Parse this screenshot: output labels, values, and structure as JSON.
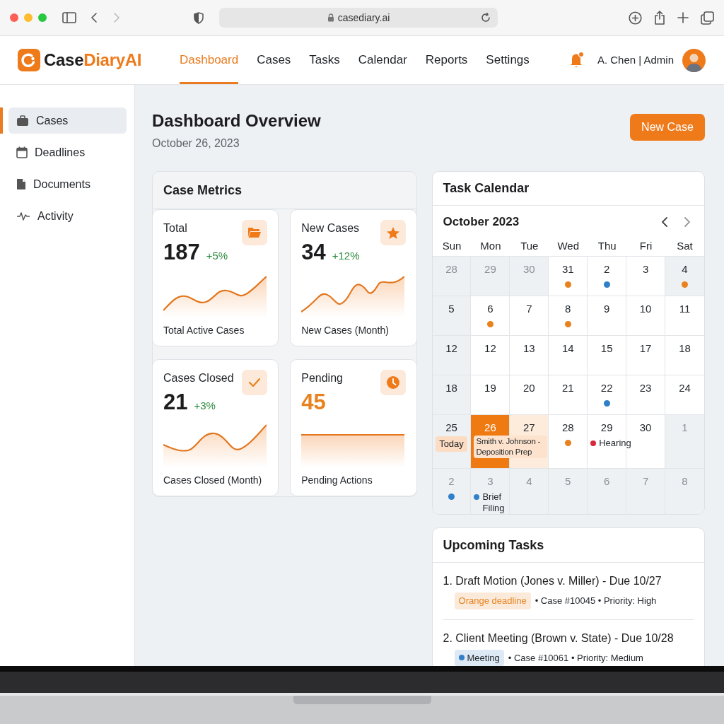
{
  "browser": {
    "url": "casediary.ai"
  },
  "brand": {
    "plain": "Case",
    "accent": "DiaryAI"
  },
  "nav": [
    {
      "label": "Dashboard",
      "selected": true
    },
    {
      "label": "Cases",
      "selected": false
    },
    {
      "label": "Tasks",
      "selected": false
    },
    {
      "label": "Calendar",
      "selected": false
    },
    {
      "label": "Reports",
      "selected": false
    },
    {
      "label": "Settings",
      "selected": false
    }
  ],
  "user": {
    "name": "A. Chen | Admin",
    "has_notification": true
  },
  "sidebar": {
    "items": [
      {
        "label": "Cases",
        "selected": true
      },
      {
        "label": "Deadlines",
        "selected": false
      },
      {
        "label": "Documents",
        "selected": false
      },
      {
        "label": "Activity",
        "selected": false
      }
    ]
  },
  "page": {
    "title": "Dashboard Overview",
    "date": "October 26, 2023",
    "primary_button": "New Case"
  },
  "metrics": {
    "title": "Case Metrics",
    "cards": [
      {
        "title": "Total",
        "value": "187",
        "change": "+5%",
        "caption": "Total Active Cases",
        "emphasized": false
      },
      {
        "title": "New Cases",
        "value": "34",
        "change": "+12%",
        "caption": "New Cases (Month)",
        "emphasized": false
      },
      {
        "title": "Cases Closed",
        "value": "21",
        "change": "+3%",
        "caption": "Cases Closed (Month)",
        "emphasized": false
      },
      {
        "title": "Pending",
        "value": "45",
        "caption": "Pending Actions",
        "emphasized": true
      }
    ]
  },
  "calendar": {
    "title": "Task Calendar",
    "month": "October 2023",
    "weekdays": [
      "Sun",
      "Mon",
      "Tue",
      "Wed",
      "Thu",
      "Fri",
      "Sat"
    ],
    "weeks": [
      [
        {
          "day": "28",
          "outside": true,
          "shaded": true,
          "today": false,
          "tinted": false
        },
        {
          "day": "29",
          "outside": true,
          "shaded": true,
          "today": false,
          "tinted": false
        },
        {
          "day": "30",
          "outside": true,
          "shaded": true,
          "today": false,
          "tinted": false
        },
        {
          "day": "31",
          "outside": false,
          "shaded": false,
          "today": false,
          "tinted": false,
          "dot": {
            "color": "#e8821e"
          }
        },
        {
          "day": "2",
          "outside": false,
          "shaded": false,
          "today": false,
          "tinted": false,
          "dot": {
            "color": "#2f80c9"
          }
        },
        {
          "day": "3",
          "outside": false,
          "shaded": false,
          "today": false,
          "tinted": false
        },
        {
          "day": "4",
          "outside": false,
          "shaded": true,
          "today": false,
          "tinted": false,
          "dot": {
            "color": "#e8821e"
          }
        }
      ],
      [
        {
          "day": "5",
          "outside": false,
          "shaded": true,
          "today": false,
          "tinted": false
        },
        {
          "day": "6",
          "outside": false,
          "shaded": false,
          "today": false,
          "tinted": false,
          "dot": {
            "color": "#e8821e"
          }
        },
        {
          "day": "7",
          "outside": false,
          "shaded": false,
          "today": false,
          "tinted": false
        },
        {
          "day": "8",
          "outside": false,
          "shaded": false,
          "today": false,
          "tinted": false,
          "dot": {
            "color": "#e8821e"
          }
        },
        {
          "day": "9",
          "outside": false,
          "shaded": false,
          "today": false,
          "tinted": false
        },
        {
          "day": "10",
          "outside": false,
          "shaded": false,
          "today": false,
          "tinted": false
        },
        {
          "day": "11",
          "outside": false,
          "shaded": false,
          "today": false,
          "tinted": false
        }
      ],
      [
        {
          "day": "12",
          "outside": false,
          "shaded": true,
          "today": false,
          "tinted": false
        },
        {
          "day": "12",
          "outside": false,
          "shaded": false,
          "today": false,
          "tinted": false
        },
        {
          "day": "13",
          "outside": false,
          "shaded": false,
          "today": false,
          "tinted": false
        },
        {
          "day": "14",
          "outside": false,
          "shaded": false,
          "today": false,
          "tinted": false
        },
        {
          "day": "15",
          "outside": false,
          "shaded": false,
          "today": false,
          "tinted": false
        },
        {
          "day": "17",
          "outside": false,
          "shaded": false,
          "today": false,
          "tinted": false
        },
        {
          "day": "18",
          "outside": false,
          "shaded": false,
          "today": false,
          "tinted": false
        }
      ],
      [
        {
          "day": "18",
          "outside": false,
          "shaded": true,
          "today": false,
          "tinted": false
        },
        {
          "day": "19",
          "outside": false,
          "shaded": false,
          "today": false,
          "tinted": false
        },
        {
          "day": "20",
          "outside": false,
          "shaded": false,
          "today": false,
          "tinted": false
        },
        {
          "day": "21",
          "outside": false,
          "shaded": false,
          "today": false,
          "tinted": false
        },
        {
          "day": "22",
          "outside": false,
          "shaded": false,
          "today": false,
          "tinted": false,
          "dot": {
            "color": "#2f80c9"
          }
        },
        {
          "day": "23",
          "outside": false,
          "shaded": false,
          "today": false,
          "tinted": false
        },
        {
          "day": "24",
          "outside": false,
          "shaded": false,
          "today": false,
          "tinted": false
        }
      ],
      [
        {
          "day": "25",
          "outside": false,
          "shaded": true,
          "today": false,
          "tinted": false,
          "event": {
            "kind": "tag",
            "text": "Today"
          }
        },
        {
          "day": "26",
          "outside": false,
          "shaded": false,
          "today": true,
          "tinted": false,
          "event": {
            "kind": "wide",
            "text": "Smith v. Johnson - Deposition Prep"
          }
        },
        {
          "day": "27",
          "outside": false,
          "shaded": false,
          "today": false,
          "tinted": true
        },
        {
          "day": "28",
          "outside": false,
          "shaded": false,
          "today": false,
          "tinted": false,
          "dot": {
            "color": "#e8821e"
          }
        },
        {
          "day": "29",
          "outside": false,
          "shaded": false,
          "today": false,
          "tinted": false,
          "event": {
            "kind": "dot",
            "text": "Hearing",
            "color": "#d42a3a"
          }
        },
        {
          "day": "30",
          "outside": false,
          "shaded": false,
          "today": false,
          "tinted": false
        },
        {
          "day": "1",
          "outside": true,
          "shaded": true,
          "today": false,
          "tinted": false
        }
      ],
      [
        {
          "day": "2",
          "outside": true,
          "shaded": true,
          "today": false,
          "tinted": false,
          "dot": {
            "color": "#2f80c9"
          }
        },
        {
          "day": "3",
          "outside": true,
          "shaded": true,
          "today": false,
          "tinted": false,
          "event": {
            "kind": "dot",
            "text": "Brief Filing",
            "color": "#2f80c9"
          }
        },
        {
          "day": "4",
          "outside": true,
          "shaded": true,
          "today": false,
          "tinted": false
        },
        {
          "day": "5",
          "outside": true,
          "shaded": true,
          "today": false,
          "tinted": false
        },
        {
          "day": "6",
          "outside": true,
          "shaded": true,
          "today": false,
          "tinted": false
        },
        {
          "day": "7",
          "outside": true,
          "shaded": true,
          "today": false,
          "tinted": false
        },
        {
          "day": "8",
          "outside": true,
          "shaded": true,
          "today": false,
          "tinted": false
        }
      ]
    ]
  },
  "upcoming": {
    "title": "Upcoming Tasks",
    "items": [
      {
        "title": "1. Draft Motion (Jones v. Miller) - Due 10/27",
        "tag": {
          "text": "Orange deadline",
          "color": "#e8821e",
          "dotted": false
        },
        "meta": "• Case #10045 • Priority: High"
      },
      {
        "title": "2. Client Meeting (Brown v. State) - Due 10/28",
        "tag": {
          "text": "Meeting",
          "color": "#2f80c9",
          "dotted": true
        },
        "meta": "• Case #10061 • Priority: Medium"
      }
    ]
  }
}
